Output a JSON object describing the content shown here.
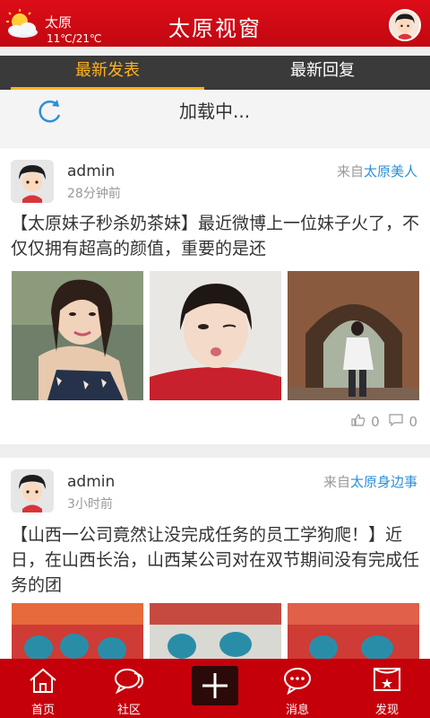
{
  "header": {
    "city": "太原",
    "temperature": "11℃/21℃",
    "title": "太原视窗"
  },
  "tabs": [
    {
      "label": "最新发表",
      "active": true
    },
    {
      "label": "最新回复",
      "active": false
    }
  ],
  "loading": {
    "text": "加载中..."
  },
  "posts": [
    {
      "author": "admin",
      "time": "28分钟前",
      "source_prefix": "来自",
      "source_channel": "太原美人",
      "title": "【太原妹子秒杀奶茶妹】最近微博上一位妹子火了，不仅仅拥有超高的颜值，重要的是还",
      "likes": "0",
      "comments": "0"
    },
    {
      "author": "admin",
      "time": "3小时前",
      "source_prefix": "来自",
      "source_channel": "太原身边事",
      "title": "【山西一公司竟然让没完成任务的员工学狗爬！】近日，在山西长治，山西某公司对在双节期间没有完成任务的团"
    }
  ],
  "bottom_nav": [
    {
      "label": "首页",
      "icon": "home-icon"
    },
    {
      "label": "社区",
      "icon": "chat-bubble-icon"
    },
    {
      "label": "",
      "icon": "plus-icon"
    },
    {
      "label": "消息",
      "icon": "message-icon"
    },
    {
      "label": "发现",
      "icon": "discover-flag-icon"
    }
  ],
  "colors": {
    "header_red": "#d10a14",
    "tab_accent": "#ffb21c",
    "source_blue": "#2a8fd9",
    "nav_red": "#c5000a"
  }
}
